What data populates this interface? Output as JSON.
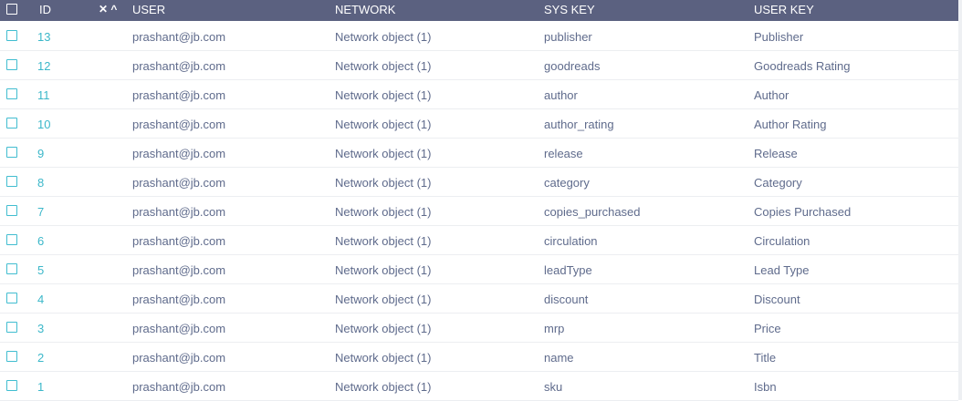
{
  "header": {
    "id": "ID",
    "user": "USER",
    "network": "NETWORK",
    "sys_key": "SYS KEY",
    "user_key": "USER KEY",
    "sort_icons": "✕ ^"
  },
  "rows": [
    {
      "id": "13",
      "user": "prashant@jb.com",
      "network": "Network object (1)",
      "sys_key": "publisher",
      "user_key": "Publisher"
    },
    {
      "id": "12",
      "user": "prashant@jb.com",
      "network": "Network object (1)",
      "sys_key": "goodreads",
      "user_key": "Goodreads Rating"
    },
    {
      "id": "11",
      "user": "prashant@jb.com",
      "network": "Network object (1)",
      "sys_key": "author",
      "user_key": "Author"
    },
    {
      "id": "10",
      "user": "prashant@jb.com",
      "network": "Network object (1)",
      "sys_key": "author_rating",
      "user_key": "Author Rating"
    },
    {
      "id": "9",
      "user": "prashant@jb.com",
      "network": "Network object (1)",
      "sys_key": "release",
      "user_key": "Release"
    },
    {
      "id": "8",
      "user": "prashant@jb.com",
      "network": "Network object (1)",
      "sys_key": "category",
      "user_key": "Category"
    },
    {
      "id": "7",
      "user": "prashant@jb.com",
      "network": "Network object (1)",
      "sys_key": "copies_purchased",
      "user_key": "Copies Purchased"
    },
    {
      "id": "6",
      "user": "prashant@jb.com",
      "network": "Network object (1)",
      "sys_key": "circulation",
      "user_key": "Circulation"
    },
    {
      "id": "5",
      "user": "prashant@jb.com",
      "network": "Network object (1)",
      "sys_key": "leadType",
      "user_key": "Lead Type"
    },
    {
      "id": "4",
      "user": "prashant@jb.com",
      "network": "Network object (1)",
      "sys_key": "discount",
      "user_key": "Discount"
    },
    {
      "id": "3",
      "user": "prashant@jb.com",
      "network": "Network object (1)",
      "sys_key": "mrp",
      "user_key": "Price"
    },
    {
      "id": "2",
      "user": "prashant@jb.com",
      "network": "Network object (1)",
      "sys_key": "name",
      "user_key": "Title"
    },
    {
      "id": "1",
      "user": "prashant@jb.com",
      "network": "Network object (1)",
      "sys_key": "sku",
      "user_key": "Isbn"
    }
  ]
}
